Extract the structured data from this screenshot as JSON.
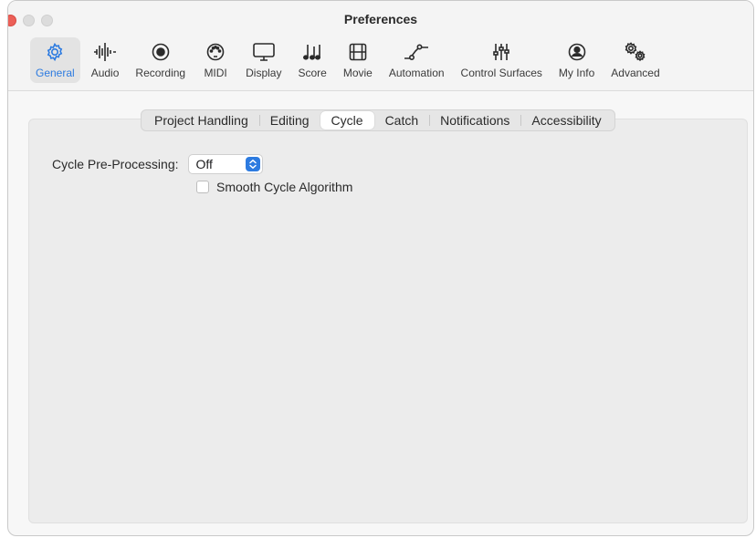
{
  "window": {
    "title": "Preferences"
  },
  "toolbar": {
    "items": [
      {
        "label": "General",
        "icon": "gear-icon",
        "active": true
      },
      {
        "label": "Audio",
        "icon": "waveform-icon",
        "active": false
      },
      {
        "label": "Recording",
        "icon": "record-icon",
        "active": false
      },
      {
        "label": "MIDI",
        "icon": "midi-connector-icon",
        "active": false
      },
      {
        "label": "Display",
        "icon": "monitor-icon",
        "active": false
      },
      {
        "label": "Score",
        "icon": "music-notes-icon",
        "active": false
      },
      {
        "label": "Movie",
        "icon": "film-icon",
        "active": false
      },
      {
        "label": "Automation",
        "icon": "automation-curve-icon",
        "active": false
      },
      {
        "label": "Control Surfaces",
        "icon": "sliders-icon",
        "active": false
      },
      {
        "label": "My Info",
        "icon": "person-circle-icon",
        "active": false
      },
      {
        "label": "Advanced",
        "icon": "gears-icon",
        "active": false
      }
    ],
    "accent_color": "#2d7be0"
  },
  "tabs": {
    "items": [
      "Project Handling",
      "Editing",
      "Cycle",
      "Catch",
      "Notifications",
      "Accessibility"
    ],
    "selected": "Cycle"
  },
  "cycle": {
    "preprocessing_label": "Cycle Pre-Processing:",
    "preprocessing_value": "Off",
    "smooth_label": "Smooth Cycle Algorithm",
    "smooth_checked": false
  }
}
